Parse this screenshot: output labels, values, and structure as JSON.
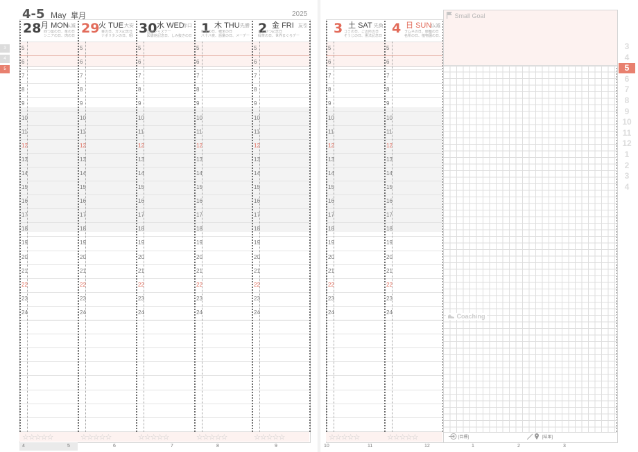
{
  "header": {
    "date_range": "4-5",
    "month_en": "May",
    "month_jp": "皐月",
    "year": "2025"
  },
  "days_left": [
    {
      "num": "28",
      "wk_jp": "月",
      "wk_en": "MON",
      "rokuyo": "仏滅",
      "notes": [
        "四つ葉の日、象の日",
        "シニアの日、肉の日"
      ],
      "red": false
    },
    {
      "num": "29",
      "wk_jp": "火",
      "wk_en": "TUE",
      "rokuyo": "大安",
      "notes": [
        "畳の日、ガス記念日",
        "ナポリタンの日、昭和の日"
      ],
      "red": true
    },
    {
      "num": "30",
      "wk_jp": "水",
      "wk_en": "WED",
      "rokuyo": "赤口",
      "notes": [
        "国際ジャズデー",
        "図書館記念日、しみ抜きの日"
      ],
      "red": false
    },
    {
      "num": "1",
      "wk_jp": "木",
      "wk_en": "THU",
      "rokuyo": "先勝",
      "notes": [
        "新茶の日、穂米の日",
        "八十八夜、語彙の日、メーデー"
      ],
      "red": false
    },
    {
      "num": "2",
      "wk_jp": "金",
      "wk_en": "FRI",
      "rokuyo": "友引",
      "notes": [
        "えんぴつ記念日",
        "緑茶の日、世界まぐろデー"
      ],
      "red": false
    }
  ],
  "days_right": [
    {
      "num": "3",
      "wk_jp": "土",
      "wk_en": "SAT",
      "rokuyo": "先負",
      "notes": [
        "ゴミの日、ご近所の日",
        "そうじの日、憲法記念日"
      ],
      "red": true
    },
    {
      "num": "4",
      "wk_jp": "日",
      "wk_en": "SUN",
      "rokuyo": "仏滅",
      "notes": [
        "ラムネの日、競輪の日",
        "名所の日、植物園の日、みどりの日"
      ],
      "red": true
    }
  ],
  "hours": [
    "5",
    "6",
    "7",
    "8",
    "9",
    "10",
    "11",
    "12",
    "13",
    "14",
    "15",
    "16",
    "17",
    "18",
    "19",
    "20",
    "21",
    "22",
    "23",
    "24"
  ],
  "stars": "☆☆☆☆☆",
  "small_goal": "Small  Goal",
  "coaching": "Coaching",
  "goal_label": "[目標]",
  "result_label": "[結果]",
  "bottom_left": [
    "4",
    "5",
    "6",
    "7",
    "8",
    "9"
  ],
  "bottom_right": [
    "10",
    "11",
    "12",
    "1",
    "2",
    "3"
  ],
  "month_tabs": [
    "3",
    "4",
    "5",
    "6",
    "7",
    "8",
    "9",
    "10",
    "11",
    "12",
    "1",
    "2",
    "3",
    "4"
  ],
  "active_month_tab": "5",
  "left_tabs": [
    "3",
    "4",
    "5"
  ],
  "colors": {
    "accent": "#e26b5a",
    "pink": "#fdf2f0"
  }
}
